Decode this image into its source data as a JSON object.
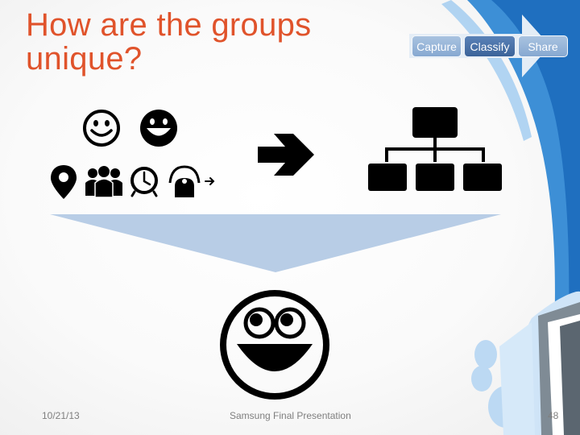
{
  "slide": {
    "title_line1": "How are the groups",
    "title_line2": "unique?"
  },
  "nav": {
    "steps": [
      {
        "label": "Capture",
        "state": "inactive"
      },
      {
        "label": "Classify",
        "state": "active"
      },
      {
        "label": "Share",
        "state": "inactive"
      }
    ]
  },
  "icons": {
    "row1": [
      "smiley-outline-icon",
      "smiley-filled-icon"
    ],
    "row2": [
      "location-pin-icon",
      "people-group-icon",
      "clock-icon",
      "proximity-sensor-icon"
    ],
    "middle": "right-arrow-icon",
    "hierarchy": "org-chart-icon",
    "result": "big-laughing-smiley-icon"
  },
  "colors": {
    "title": "#e0532b",
    "funnel": "#b8cde6",
    "nav_active": "#4670a6",
    "nav_inactive": "#9bb8da",
    "deco_blue": "#3d8fd6"
  },
  "footer": {
    "date": "10/21/13",
    "center": "Samsung Final Presentation",
    "page": "48"
  }
}
